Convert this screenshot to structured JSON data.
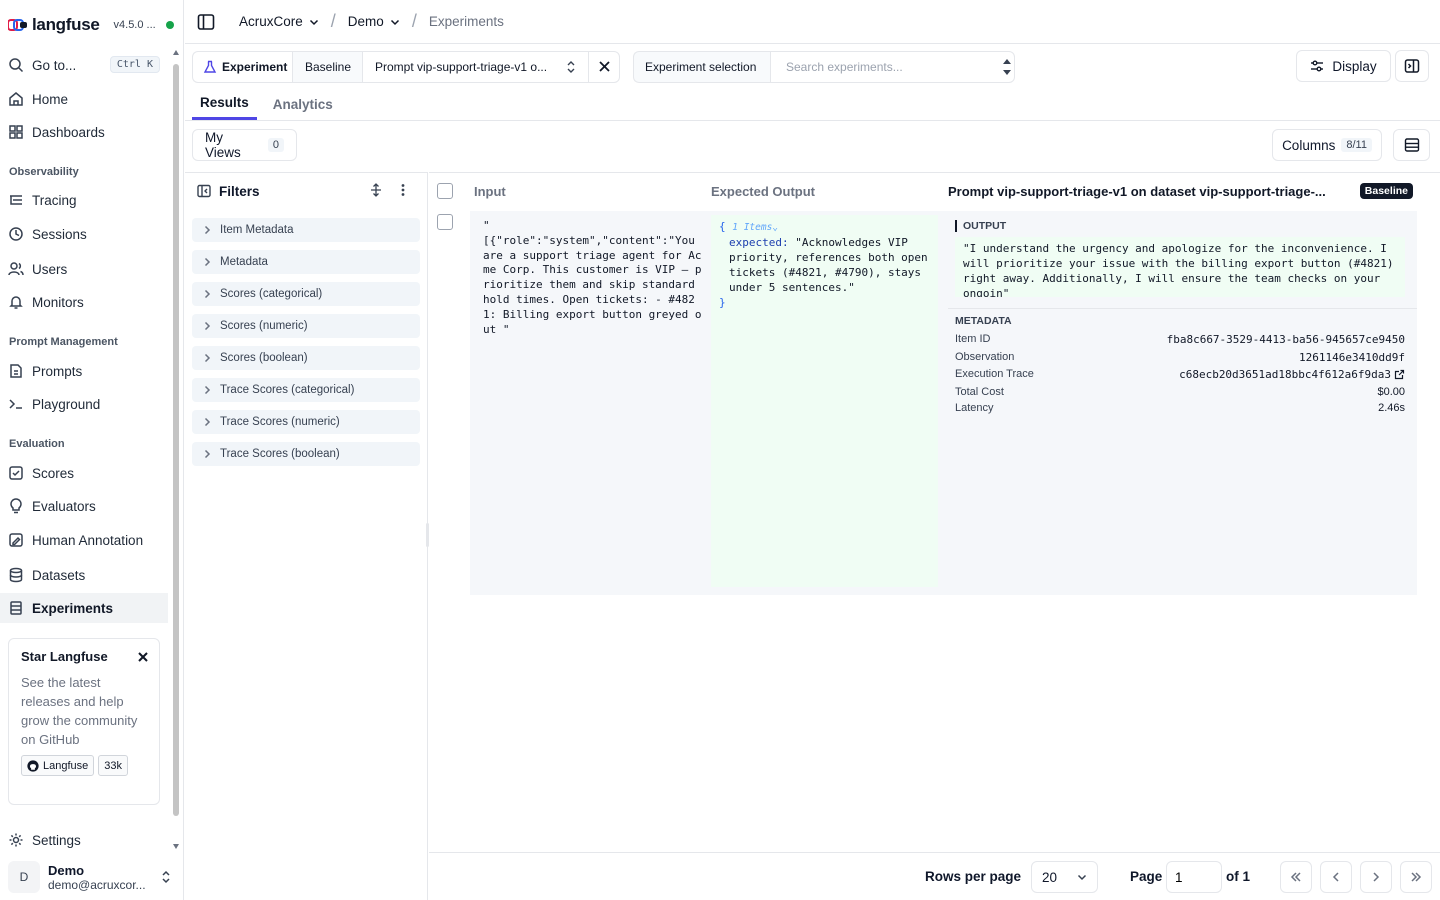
{
  "app": {
    "name": "langfuse",
    "version": "v4.5.0 ..."
  },
  "sidebar": {
    "goto": {
      "label": "Go to...",
      "shortcut": "Ctrl K"
    },
    "top_items": [
      {
        "label": "Home",
        "icon": "home-icon"
      },
      {
        "label": "Dashboards",
        "icon": "dashboard-icon"
      }
    ],
    "sections": [
      {
        "title": "Observability",
        "items": [
          {
            "label": "Tracing",
            "icon": "tracing-icon"
          },
          {
            "label": "Sessions",
            "icon": "clock-icon"
          },
          {
            "label": "Users",
            "icon": "users-icon"
          },
          {
            "label": "Monitors",
            "icon": "bell-icon"
          }
        ]
      },
      {
        "title": "Prompt Management",
        "items": [
          {
            "label": "Prompts",
            "icon": "file-icon"
          },
          {
            "label": "Playground",
            "icon": "terminal-icon"
          }
        ]
      },
      {
        "title": "Evaluation",
        "items": [
          {
            "label": "Scores",
            "icon": "check-square-icon"
          },
          {
            "label": "Evaluators",
            "icon": "lightbulb-icon"
          },
          {
            "label": "Human Annotation",
            "icon": "annotation-icon"
          },
          {
            "label": "Datasets",
            "icon": "database-icon"
          },
          {
            "label": "Experiments",
            "icon": "flask-icon",
            "active": true
          }
        ]
      }
    ],
    "star_card": {
      "title": "Star Langfuse",
      "description": "See the latest releases and help grow the community on GitHub",
      "github_label": "Langfuse",
      "stars": "33k"
    },
    "settings": "Settings",
    "user": {
      "initial": "D",
      "name": "Demo",
      "email": "demo@acruxcor..."
    }
  },
  "breadcrumb": {
    "org": "AcruxCore",
    "project": "Demo",
    "page": "Experiments"
  },
  "experiment_bar": {
    "experiment_label": "Experiment",
    "baseline_label": "Baseline",
    "baseline_value": "Prompt vip-support-triage-v1 o...",
    "selection_label": "Experiment selection",
    "search_placeholder": "Search experiments...",
    "display_label": "Display"
  },
  "tabs": [
    {
      "label": "Results",
      "active": true
    },
    {
      "label": "Analytics",
      "active": false
    }
  ],
  "views": {
    "label": "My Views",
    "count": "0"
  },
  "columns": {
    "label": "Columns",
    "count": "8/11"
  },
  "filters": {
    "title": "Filters",
    "items": [
      "Item Metadata",
      "Metadata",
      "Scores (categorical)",
      "Scores (numeric)",
      "Scores (boolean)",
      "Trace Scores (categorical)",
      "Trace Scores (numeric)",
      "Trace Scores (boolean)"
    ]
  },
  "table": {
    "headers": {
      "input": "Input",
      "expected": "Expected Output",
      "run": "Prompt vip-support-triage-v1 on dataset vip-support-triage-...",
      "run_badge": "Baseline"
    },
    "row": {
      "input": "\"\n[{\"role\":\"system\",\"content\":\"You are a support triage agent for Acme Corp. This customer is VIP — prioritize them and skip standard hold times. Open tickets: - #4821: Billing export button greyed out \"",
      "expected_brace_open": "{",
      "expected_items": "1 Items",
      "expected_key": "expected:",
      "expected_value": "\"Acknowledges VIP priority, references both open tickets (#4821, #4790), stays under 5 sentences.\"",
      "expected_brace_close": "}",
      "output_label": "OUTPUT",
      "output": "\"I understand the urgency and apologize for the inconvenience. I will prioritize your issue with the billing export button (#4821) right away. Additionally, I will ensure the team checks on your ongoin\"",
      "metadata_label": "METADATA",
      "metadata": [
        {
          "key": "Item ID",
          "value": "fba8c667-3529-4413-ba56-945657ce9450"
        },
        {
          "key": "Observation",
          "value": "1261146e3410dd9f"
        },
        {
          "key": "Execution Trace",
          "value": "c68ecb20d3651ad18bbc4f612a6f9da3"
        },
        {
          "key": "Total Cost",
          "value": "$0.00"
        },
        {
          "key": "Latency",
          "value": "2.46s"
        }
      ]
    }
  },
  "pagination": {
    "rows_label": "Rows per page",
    "rows_value": "20",
    "page_label": "Page",
    "page_value": "1",
    "of_label": "of 1"
  },
  "colors": {
    "accent": "#4f46e5",
    "status_green": "#16a34a",
    "expected_bg": "#f0fdf4"
  }
}
